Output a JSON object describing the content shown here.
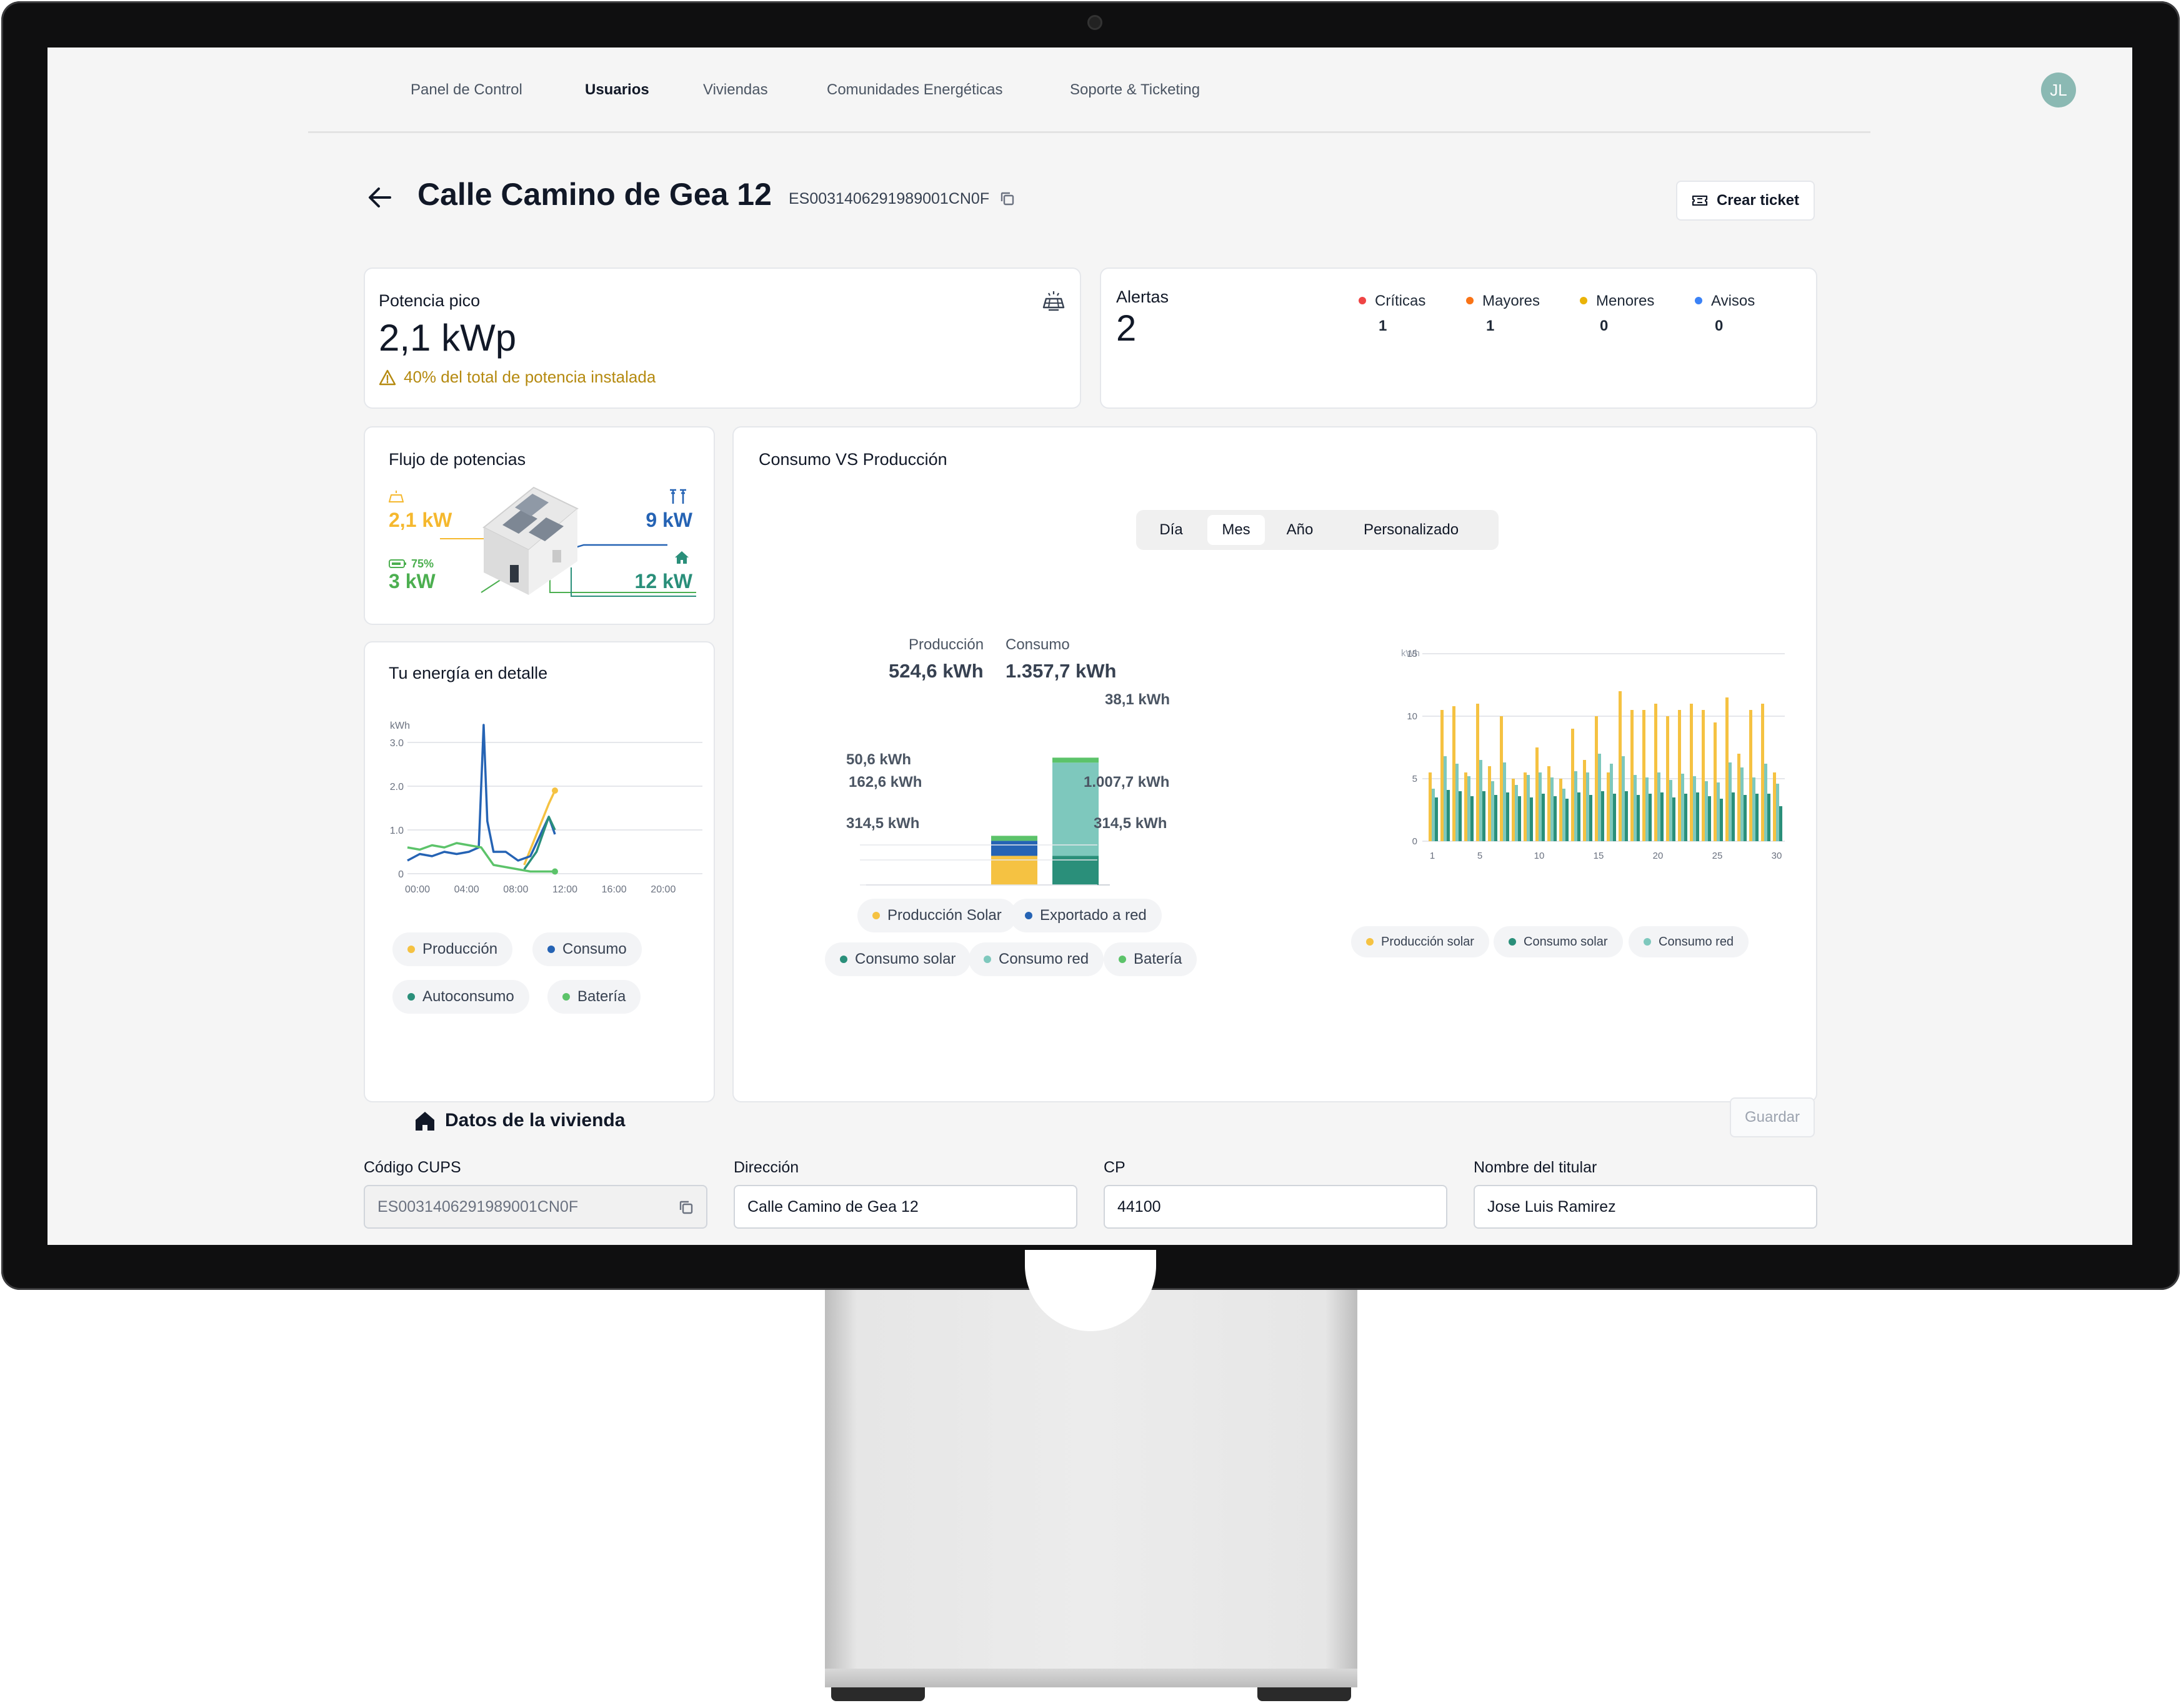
{
  "nav": {
    "items": [
      {
        "label": "Panel de Control"
      },
      {
        "label": "Usuarios"
      },
      {
        "label": "Viviendas"
      },
      {
        "label": "Comunidades Energéticas"
      },
      {
        "label": "Soporte & Ticketing"
      }
    ],
    "active": "Usuarios",
    "avatar_initials": "JL"
  },
  "header": {
    "title": "Calle Camino de Gea 12",
    "cups": "ES0031406291989001CN0F",
    "create_ticket_label": "Crear ticket"
  },
  "peak_power": {
    "title": "Potencia pico",
    "value": "2,1 kWp",
    "warning": "40% del total de potencia instalada"
  },
  "alerts": {
    "title": "Alertas",
    "total": "2",
    "levels": [
      {
        "label": "Críticas",
        "count": "1",
        "color": "#ef4444"
      },
      {
        "label": "Mayores",
        "count": "1",
        "color": "#f97316"
      },
      {
        "label": "Menores",
        "count": "0",
        "color": "#eab308"
      },
      {
        "label": "Avisos",
        "count": "0",
        "color": "#3b82f6"
      }
    ]
  },
  "power_flow": {
    "title": "Flujo de potencias",
    "solar": "2,1 kW",
    "grid": "9 kW",
    "battery_pct": "75%",
    "battery": "3 kW",
    "home": "12 kW",
    "colors": {
      "solar": "#f5b82e",
      "grid": "#2563b4",
      "battery": "#4caf50",
      "home": "#2a8f7a"
    }
  },
  "energy_detail": {
    "title": "Tu energía en detalle",
    "legend": [
      {
        "label": "Producción",
        "color": "#f5c242"
      },
      {
        "label": "Consumo",
        "color": "#2563b4"
      },
      {
        "label": "Autoconsumo",
        "color": "#2a8f7a"
      },
      {
        "label": "Batería",
        "color": "#5cc36a"
      }
    ]
  },
  "consumption_vs_production": {
    "title": "Consumo VS Producción",
    "periods": [
      "Día",
      "Mes",
      "Año",
      "Personalizado"
    ],
    "active_period": "Mes",
    "production_label": "Producción",
    "production_total": "524,6 kWh",
    "consumption_label": "Consumo",
    "consumption_total": "1.357,7 kWh",
    "production_breakdown": [
      "50,6 kWh",
      "162,6 kWh",
      "314,5 kWh"
    ],
    "consumption_breakdown": [
      "38,1 kWh",
      "1.007,7 kWh",
      "314,5 kWh"
    ],
    "legend": [
      {
        "label": "Producción Solar",
        "color": "#f5c242"
      },
      {
        "label": "Exportado a red",
        "color": "#2563b4"
      },
      {
        "label": "Consumo solar",
        "color": "#2a8f7a"
      },
      {
        "label": "Consumo red",
        "color": "#7ec8bd"
      },
      {
        "label": "Batería",
        "color": "#5cc36a"
      }
    ],
    "daily_legend": [
      {
        "label": "Producción solar",
        "color": "#f5c242"
      },
      {
        "label": "Consumo solar",
        "color": "#2a8f7a"
      },
      {
        "label": "Consumo red",
        "color": "#7ec8bd"
      }
    ]
  },
  "chart_data": [
    {
      "type": "line",
      "title": "Tu energía en detalle",
      "ylabel": "kWh",
      "ylim": [
        0,
        3.0
      ],
      "yticks": [
        "0",
        "1.0",
        "2.0",
        "3.0"
      ],
      "x": [
        "00:00",
        "04:00",
        "08:00",
        "12:00",
        "16:00",
        "20:00"
      ],
      "series": [
        {
          "name": "Producción",
          "points": [
            [
              9.5,
              0.2
            ],
            [
              10.5,
              0.9
            ],
            [
              11.5,
              1.6
            ],
            [
              12,
              1.9
            ]
          ]
        },
        {
          "name": "Consumo",
          "points": [
            [
              0,
              0.3
            ],
            [
              1,
              0.45
            ],
            [
              2,
              0.4
            ],
            [
              3,
              0.5
            ],
            [
              4,
              0.45
            ],
            [
              5,
              0.5
            ],
            [
              5.8,
              0.6
            ],
            [
              6.2,
              3.4
            ],
            [
              6.5,
              1.2
            ],
            [
              7,
              0.5
            ],
            [
              8,
              0.5
            ],
            [
              9,
              0.3
            ],
            [
              10,
              0.4
            ],
            [
              11,
              1.0
            ],
            [
              11.5,
              1.3
            ],
            [
              12,
              0.9
            ]
          ]
        },
        {
          "name": "Autoconsumo",
          "points": [
            [
              9.5,
              0.1
            ],
            [
              10.5,
              0.5
            ],
            [
              11.5,
              1.3
            ],
            [
              12,
              1.0
            ]
          ]
        },
        {
          "name": "Batería",
          "points": [
            [
              0,
              0.6
            ],
            [
              1,
              0.55
            ],
            [
              2,
              0.65
            ],
            [
              3,
              0.6
            ],
            [
              4,
              0.7
            ],
            [
              5,
              0.65
            ],
            [
              6,
              0.6
            ],
            [
              7,
              0.2
            ],
            [
              8,
              0.15
            ],
            [
              9,
              0.1
            ],
            [
              10,
              0.05
            ],
            [
              12,
              0.05
            ]
          ]
        }
      ]
    },
    {
      "type": "bar",
      "stacked": true,
      "categories": [
        "Producción",
        "Consumo"
      ],
      "series": [
        {
          "name": "Producción Solar",
          "values": [
            314.5,
            0
          ]
        },
        {
          "name": "Exportado a red",
          "values": [
            162.6,
            0
          ]
        },
        {
          "name": "Consumo solar",
          "values": [
            0,
            314.5
          ]
        },
        {
          "name": "Consumo red",
          "values": [
            0,
            1007.7
          ]
        },
        {
          "name": "Batería",
          "values": [
            50.6,
            38.1
          ]
        }
      ]
    },
    {
      "type": "bar",
      "ylabel": "kWh",
      "ylim": [
        0,
        15
      ],
      "yticks": [
        0,
        5,
        10,
        15
      ],
      "xticks": [
        1,
        5,
        10,
        15,
        20,
        25,
        30
      ],
      "x": [
        1,
        2,
        3,
        4,
        5,
        6,
        7,
        8,
        9,
        10,
        11,
        12,
        13,
        14,
        15,
        16,
        17,
        18,
        19,
        20,
        21,
        22,
        23,
        24,
        25,
        26,
        27,
        28,
        29,
        30
      ],
      "series": [
        {
          "name": "Producción solar",
          "values": [
            5.5,
            10.5,
            10.8,
            5.5,
            11,
            6,
            10,
            5,
            5.5,
            7.5,
            6,
            5,
            9,
            6.5,
            10,
            5.5,
            12,
            10.5,
            10.5,
            11,
            10,
            10.5,
            11,
            10.5,
            9.5,
            11.5,
            7,
            10.5,
            11,
            5.5
          ]
        },
        {
          "name": "Consumo red",
          "values": [
            4.2,
            6.8,
            6.2,
            5.2,
            6.5,
            4.8,
            6.3,
            4.5,
            5.3,
            5.5,
            5.1,
            4.2,
            5.6,
            5.5,
            7,
            6.2,
            6.8,
            5.3,
            5.1,
            5.5,
            4.9,
            5.4,
            5.2,
            4.8,
            4.7,
            6.3,
            5.9,
            5.1,
            6.2,
            4.6
          ]
        },
        {
          "name": "Consumo solar",
          "values": [
            3.5,
            4.1,
            4.0,
            3.6,
            4.0,
            3.7,
            3.9,
            3.6,
            3.5,
            3.8,
            3.6,
            3.4,
            3.9,
            3.7,
            4.0,
            3.8,
            4.0,
            3.7,
            3.8,
            3.9,
            3.5,
            3.8,
            3.9,
            3.6,
            3.4,
            3.9,
            3.7,
            3.8,
            3.8,
            2.8
          ]
        }
      ]
    }
  ],
  "house_data": {
    "title": "Datos de la vivienda",
    "save_label": "Guardar",
    "fields": [
      {
        "label": "Código CUPS",
        "value": "ES0031406291989001CN0F"
      },
      {
        "label": "Dirección",
        "value": "Calle Camino de Gea 12"
      },
      {
        "label": "CP",
        "value": "44100"
      },
      {
        "label": "Nombre del titular",
        "value": "Jose Luis Ramirez"
      }
    ]
  }
}
